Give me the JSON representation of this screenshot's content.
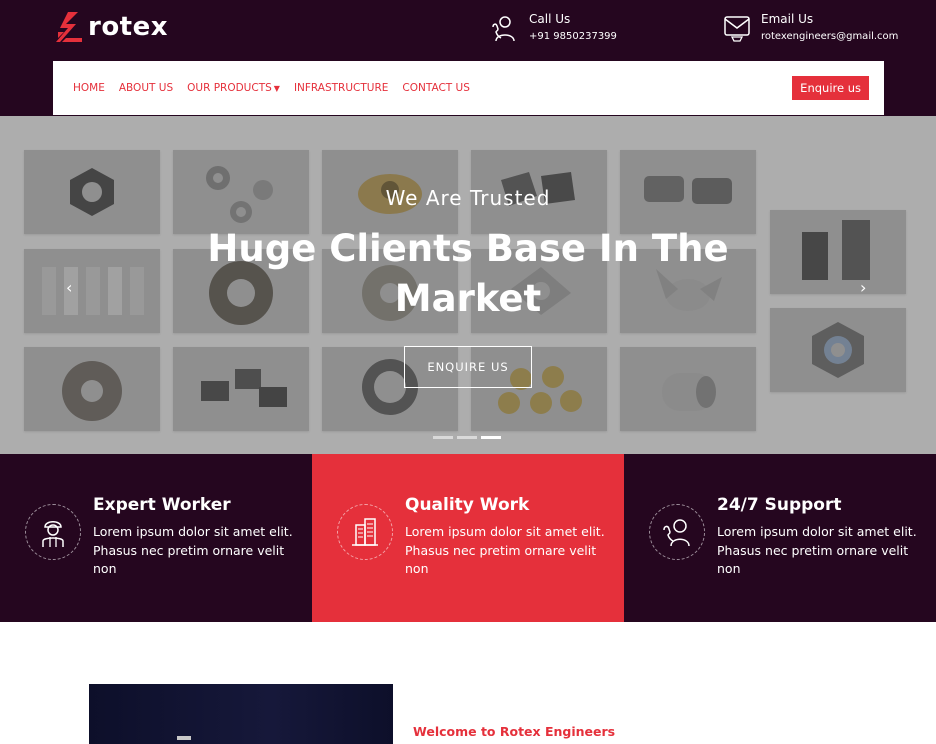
{
  "brand": {
    "name": "rotex"
  },
  "header": {
    "call": {
      "title": "Call Us",
      "value": "+91 9850237399"
    },
    "email": {
      "title": "Email Us",
      "value": "rotexengineers@gmail.com"
    }
  },
  "nav": {
    "items": [
      "HOME",
      "ABOUT US",
      "OUR PRODUCTS",
      "INFRASTRUCTURE",
      "CONTACT US"
    ],
    "enquire": "Enquire us"
  },
  "hero": {
    "subtitle": "We Are Trusted",
    "title_line1": "Huge Clients Base In The",
    "title_line2": "Market",
    "button": "ENQUIRE US",
    "active_slide": 3,
    "slides": 3
  },
  "features": [
    {
      "title": "Expert Worker",
      "text": "Lorem ipsum dolor sit amet elit. Phasus nec pretim ornare velit non",
      "icon": "worker-icon"
    },
    {
      "title": "Quality Work",
      "text": "Lorem ipsum dolor sit amet elit. Phasus nec pretim ornare velit non",
      "icon": "building-icon"
    },
    {
      "title": "24/7 Support",
      "text": "Lorem ipsum dolor sit amet elit. Phasus nec pretim ornare velit non",
      "icon": "support-icon"
    }
  ],
  "about": {
    "welcome": "Welcome to Rotex Engineers"
  },
  "colors": {
    "dark": "#25061f",
    "accent": "#e5303b"
  }
}
